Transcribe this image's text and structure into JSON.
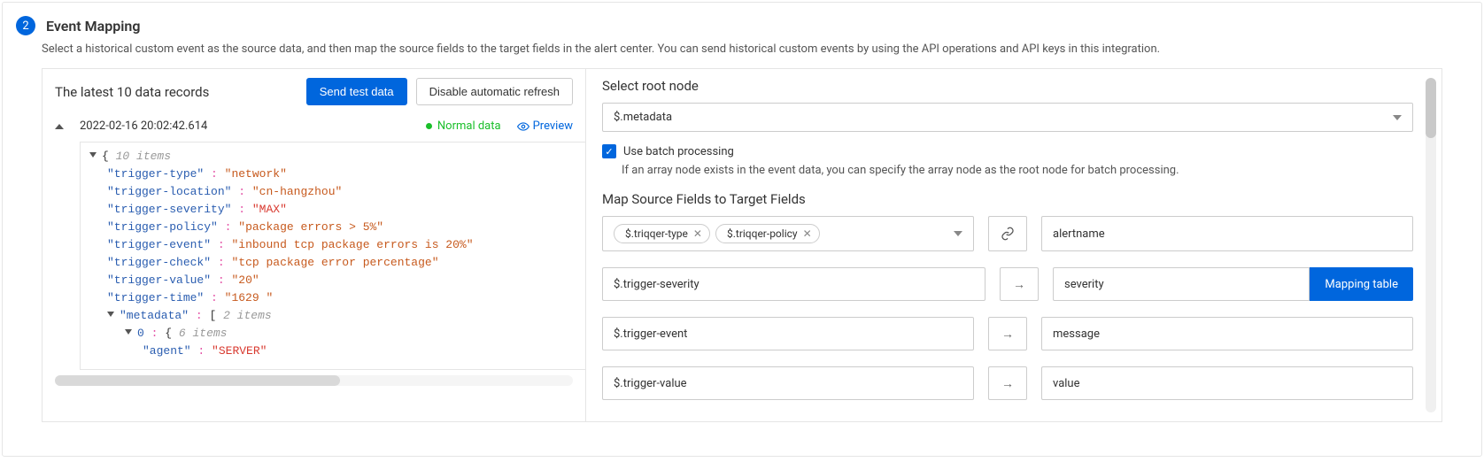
{
  "step_number": "2",
  "section_title": "Event Mapping",
  "section_desc": "Select a historical custom event as the source data, and then map the source fields to the target fields in the alert center. You can send historical custom events by using the API operations and API keys in this integration.",
  "left": {
    "title": "The latest 10 data records",
    "send_btn": "Send test data",
    "disable_btn": "Disable automatic refresh",
    "record_time": "2022-02-16 20:02:42.614",
    "status_label": "Normal data",
    "preview_label": "Preview"
  },
  "json": {
    "root_meta": "10 items",
    "k0": "\"trigger-type\"",
    "v0": "\"network\"",
    "k1": "\"trigger-location\"",
    "v1": "\"cn-hangzhou\"",
    "k2": "\"trigger-severity\"",
    "v2": "\"MAX\"",
    "k3": "\"trigger-policy\"",
    "v3": "\"package errors > 5%\"",
    "k4": "\"trigger-event\"",
    "v4": "\"inbound tcp package errors is 20%\"",
    "k5": "\"trigger-check\"",
    "v5": "\"tcp package error percentage\"",
    "k6": "\"trigger-value\"",
    "v6": "\"20\"",
    "k7": "\"trigger-time\"",
    "v7": "\"1629            \"",
    "k8": "\"metadata\"",
    "v8": "[",
    "v8meta": "2 items",
    "k9": "0",
    "v9": "{",
    "v9meta": "6 items",
    "k10": "\"agent\"",
    "v10": "\"SERVER\""
  },
  "right": {
    "root_node_title": "Select root node",
    "root_node_value": "$.metadata",
    "batch_label": "Use batch processing",
    "batch_hint": "If an array node exists in the event data, you can specify the array node as the root node for batch processing.",
    "map_title": "Map Source Fields to Target Fields",
    "rows": [
      {
        "source_tags": [
          "$.triqqer-type",
          "$.triqqer-policy"
        ],
        "source_text": "",
        "arrow_type": "link",
        "target": "alertname",
        "action": ""
      },
      {
        "source_tags": [],
        "source_text": "$.trigger-severity",
        "arrow_type": "arrow",
        "target": "severity",
        "action": "Mapping table"
      },
      {
        "source_tags": [],
        "source_text": "$.trigger-event",
        "arrow_type": "arrow",
        "target": "message",
        "action": ""
      },
      {
        "source_tags": [],
        "source_text": "$.trigger-value",
        "arrow_type": "arrow",
        "target": "value",
        "action": ""
      }
    ]
  }
}
